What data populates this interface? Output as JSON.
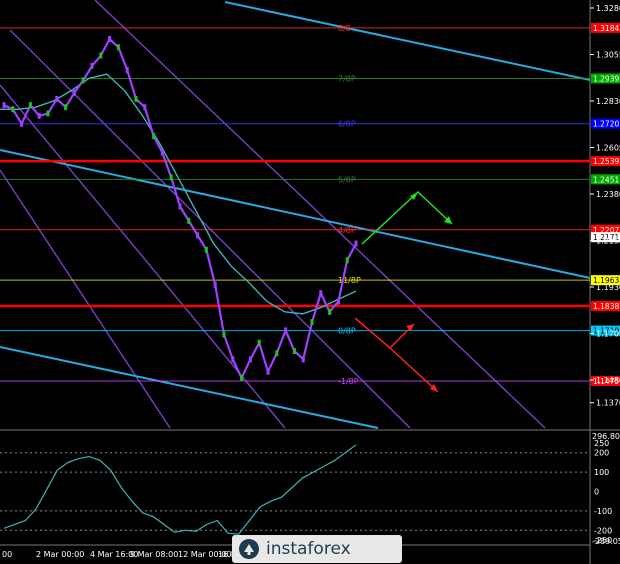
{
  "chart_data": [
    {
      "type": "line",
      "title": "",
      "instrument": "",
      "y_ticks": [
        "1.3280",
        "1.3055",
        "1.2830",
        "1.2605",
        "1.2380",
        "1.2155",
        "1.1930",
        "1.1705",
        "1.1480",
        "1.1370"
      ],
      "ylim": [
        1.137,
        1.338
      ],
      "x_ticks": [
        "00",
        "2 Mar 00:00",
        "4 Mar 16:00",
        "9 Mar 08:00",
        "12 Mar 00:00",
        "16 Mar"
      ],
      "price_badges": [
        {
          "value": "1.3184",
          "color": "#ff0000"
        },
        {
          "value": "1.2939",
          "color": "#00aa00"
        },
        {
          "value": "1.2720",
          "color": "#0000ff"
        },
        {
          "value": "1.2539",
          "color": "#ff0000"
        },
        {
          "value": "1.2451",
          "color": "#00aa00"
        },
        {
          "value": "1.2207",
          "color": "#ff0000"
        },
        {
          "value": "1.2171",
          "color": "#ffffff"
        },
        {
          "value": "1.1963",
          "color": "#ffff00"
        },
        {
          "value": "1.1838",
          "color": "#ff0000"
        },
        {
          "value": "1.1719",
          "color": "#00ccff"
        },
        {
          "value": "1.1475",
          "color": "#ff0000"
        }
      ],
      "murrey_levels": [
        {
          "label": "8/8",
          "value": 1.3184,
          "color": "#ff2a2a"
        },
        {
          "label": "7/8P",
          "value": 1.2939,
          "color": "#2e8b2e"
        },
        {
          "label": "6/8P",
          "value": 1.272,
          "color": "#3a3aff"
        },
        {
          "label": "5/8P",
          "value": 1.2451,
          "color": "#2e8b2e"
        },
        {
          "label": "4/8P",
          "value": 1.2207,
          "color": "#ff2a2a"
        },
        {
          "label": "11/8P",
          "value": 1.1963,
          "color": "#e6e600"
        },
        {
          "label": "0/8P",
          "value": 1.1719,
          "color": "#00ccff"
        },
        {
          "label": "-1/8P",
          "value": 1.1475,
          "color": "#d040ff"
        }
      ],
      "red_lines": [
        1.2539,
        1.1838
      ],
      "grid": false,
      "series": [
        {
          "values": [
            1.281,
            1.279,
            1.272,
            1.281,
            1.2758,
            1.277,
            1.284,
            1.28,
            1.287,
            1.293,
            1.3,
            1.305,
            1.313,
            1.309,
            1.298,
            1.284,
            1.28,
            1.266,
            1.258,
            1.246,
            1.232,
            1.225,
            1.218,
            1.211,
            1.194,
            1.17,
            1.158,
            1.149,
            1.158,
            1.166,
            1.152,
            1.161,
            1.172,
            1.162,
            1.158,
            1.176,
            1.19,
            1.181,
            1.186,
            1.206,
            1.214
          ]
        },
        {
          "values": [
            1.279,
            1.279,
            1.28,
            1.283,
            1.288,
            1.294,
            1.296,
            1.288,
            1.276,
            1.262,
            1.246,
            1.23,
            1.214,
            1.203,
            1.195,
            1.186,
            1.181,
            1.18,
            1.183,
            1.187,
            1.191
          ]
        }
      ]
    },
    {
      "type": "line",
      "title": "",
      "y_ticks": [
        "250",
        "200",
        "100",
        "0",
        "-100",
        "-200",
        "-250"
      ],
      "ylim": [
        -270,
        260
      ],
      "right_labels": {
        "top": "296.8025",
        "bottom": "-289.053"
      },
      "series": [
        {
          "values": [
            -190,
            -170,
            -150,
            -90,
            10,
            110,
            150,
            170,
            180,
            160,
            110,
            20,
            -50,
            -110,
            -130,
            -170,
            -210,
            -200,
            -205,
            -170,
            -150,
            -215,
            -220,
            -150,
            -80,
            -50,
            -30,
            20,
            70,
            100,
            130,
            160,
            200,
            240
          ]
        }
      ]
    }
  ],
  "watermark": {
    "text": "instaforex"
  }
}
